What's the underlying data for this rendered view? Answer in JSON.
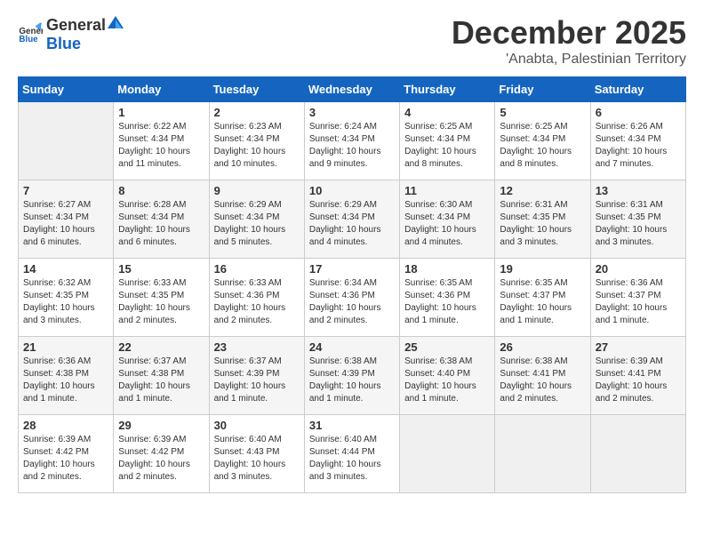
{
  "header": {
    "logo_general": "General",
    "logo_blue": "Blue",
    "month_title": "December 2025",
    "location": "'Anabta, Palestinian Territory"
  },
  "days_of_week": [
    "Sunday",
    "Monday",
    "Tuesday",
    "Wednesday",
    "Thursday",
    "Friday",
    "Saturday"
  ],
  "weeks": [
    [
      {
        "day": "",
        "sunrise": "",
        "sunset": "",
        "daylight": ""
      },
      {
        "day": "1",
        "sunrise": "Sunrise: 6:22 AM",
        "sunset": "Sunset: 4:34 PM",
        "daylight": "Daylight: 10 hours and 11 minutes."
      },
      {
        "day": "2",
        "sunrise": "Sunrise: 6:23 AM",
        "sunset": "Sunset: 4:34 PM",
        "daylight": "Daylight: 10 hours and 10 minutes."
      },
      {
        "day": "3",
        "sunrise": "Sunrise: 6:24 AM",
        "sunset": "Sunset: 4:34 PM",
        "daylight": "Daylight: 10 hours and 9 minutes."
      },
      {
        "day": "4",
        "sunrise": "Sunrise: 6:25 AM",
        "sunset": "Sunset: 4:34 PM",
        "daylight": "Daylight: 10 hours and 8 minutes."
      },
      {
        "day": "5",
        "sunrise": "Sunrise: 6:25 AM",
        "sunset": "Sunset: 4:34 PM",
        "daylight": "Daylight: 10 hours and 8 minutes."
      },
      {
        "day": "6",
        "sunrise": "Sunrise: 6:26 AM",
        "sunset": "Sunset: 4:34 PM",
        "daylight": "Daylight: 10 hours and 7 minutes."
      }
    ],
    [
      {
        "day": "7",
        "sunrise": "Sunrise: 6:27 AM",
        "sunset": "Sunset: 4:34 PM",
        "daylight": "Daylight: 10 hours and 6 minutes."
      },
      {
        "day": "8",
        "sunrise": "Sunrise: 6:28 AM",
        "sunset": "Sunset: 4:34 PM",
        "daylight": "Daylight: 10 hours and 6 minutes."
      },
      {
        "day": "9",
        "sunrise": "Sunrise: 6:29 AM",
        "sunset": "Sunset: 4:34 PM",
        "daylight": "Daylight: 10 hours and 5 minutes."
      },
      {
        "day": "10",
        "sunrise": "Sunrise: 6:29 AM",
        "sunset": "Sunset: 4:34 PM",
        "daylight": "Daylight: 10 hours and 4 minutes."
      },
      {
        "day": "11",
        "sunrise": "Sunrise: 6:30 AM",
        "sunset": "Sunset: 4:34 PM",
        "daylight": "Daylight: 10 hours and 4 minutes."
      },
      {
        "day": "12",
        "sunrise": "Sunrise: 6:31 AM",
        "sunset": "Sunset: 4:35 PM",
        "daylight": "Daylight: 10 hours and 3 minutes."
      },
      {
        "day": "13",
        "sunrise": "Sunrise: 6:31 AM",
        "sunset": "Sunset: 4:35 PM",
        "daylight": "Daylight: 10 hours and 3 minutes."
      }
    ],
    [
      {
        "day": "14",
        "sunrise": "Sunrise: 6:32 AM",
        "sunset": "Sunset: 4:35 PM",
        "daylight": "Daylight: 10 hours and 3 minutes."
      },
      {
        "day": "15",
        "sunrise": "Sunrise: 6:33 AM",
        "sunset": "Sunset: 4:35 PM",
        "daylight": "Daylight: 10 hours and 2 minutes."
      },
      {
        "day": "16",
        "sunrise": "Sunrise: 6:33 AM",
        "sunset": "Sunset: 4:36 PM",
        "daylight": "Daylight: 10 hours and 2 minutes."
      },
      {
        "day": "17",
        "sunrise": "Sunrise: 6:34 AM",
        "sunset": "Sunset: 4:36 PM",
        "daylight": "Daylight: 10 hours and 2 minutes."
      },
      {
        "day": "18",
        "sunrise": "Sunrise: 6:35 AM",
        "sunset": "Sunset: 4:36 PM",
        "daylight": "Daylight: 10 hours and 1 minute."
      },
      {
        "day": "19",
        "sunrise": "Sunrise: 6:35 AM",
        "sunset": "Sunset: 4:37 PM",
        "daylight": "Daylight: 10 hours and 1 minute."
      },
      {
        "day": "20",
        "sunrise": "Sunrise: 6:36 AM",
        "sunset": "Sunset: 4:37 PM",
        "daylight": "Daylight: 10 hours and 1 minute."
      }
    ],
    [
      {
        "day": "21",
        "sunrise": "Sunrise: 6:36 AM",
        "sunset": "Sunset: 4:38 PM",
        "daylight": "Daylight: 10 hours and 1 minute."
      },
      {
        "day": "22",
        "sunrise": "Sunrise: 6:37 AM",
        "sunset": "Sunset: 4:38 PM",
        "daylight": "Daylight: 10 hours and 1 minute."
      },
      {
        "day": "23",
        "sunrise": "Sunrise: 6:37 AM",
        "sunset": "Sunset: 4:39 PM",
        "daylight": "Daylight: 10 hours and 1 minute."
      },
      {
        "day": "24",
        "sunrise": "Sunrise: 6:38 AM",
        "sunset": "Sunset: 4:39 PM",
        "daylight": "Daylight: 10 hours and 1 minute."
      },
      {
        "day": "25",
        "sunrise": "Sunrise: 6:38 AM",
        "sunset": "Sunset: 4:40 PM",
        "daylight": "Daylight: 10 hours and 1 minute."
      },
      {
        "day": "26",
        "sunrise": "Sunrise: 6:38 AM",
        "sunset": "Sunset: 4:41 PM",
        "daylight": "Daylight: 10 hours and 2 minutes."
      },
      {
        "day": "27",
        "sunrise": "Sunrise: 6:39 AM",
        "sunset": "Sunset: 4:41 PM",
        "daylight": "Daylight: 10 hours and 2 minutes."
      }
    ],
    [
      {
        "day": "28",
        "sunrise": "Sunrise: 6:39 AM",
        "sunset": "Sunset: 4:42 PM",
        "daylight": "Daylight: 10 hours and 2 minutes."
      },
      {
        "day": "29",
        "sunrise": "Sunrise: 6:39 AM",
        "sunset": "Sunset: 4:42 PM",
        "daylight": "Daylight: 10 hours and 2 minutes."
      },
      {
        "day": "30",
        "sunrise": "Sunrise: 6:40 AM",
        "sunset": "Sunset: 4:43 PM",
        "daylight": "Daylight: 10 hours and 3 minutes."
      },
      {
        "day": "31",
        "sunrise": "Sunrise: 6:40 AM",
        "sunset": "Sunset: 4:44 PM",
        "daylight": "Daylight: 10 hours and 3 minutes."
      },
      {
        "day": "",
        "sunrise": "",
        "sunset": "",
        "daylight": ""
      },
      {
        "day": "",
        "sunrise": "",
        "sunset": "",
        "daylight": ""
      },
      {
        "day": "",
        "sunrise": "",
        "sunset": "",
        "daylight": ""
      }
    ]
  ]
}
